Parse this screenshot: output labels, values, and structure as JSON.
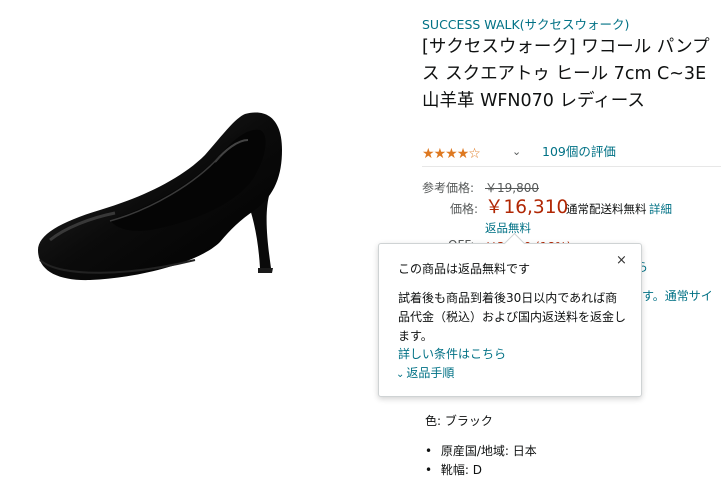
{
  "product": {
    "brand": "SUCCESS WALK(サクセスウォーク)",
    "title": "[サクセスウォーク] ワコール パンプス スクエアトゥ ヒール 7cm C~3E 山羊革 WFN070 レディース",
    "rating": {
      "stars": 4.0,
      "count_text": "109個の評価"
    }
  },
  "pricing": {
    "list_label": "参考価格:",
    "list_price": "￥19,800",
    "price_label": "価格:",
    "price": "￥16,310",
    "shipping": "通常配送料無料",
    "details_link": "詳細",
    "free_returns": "返品無料",
    "off_label": "OFF:",
    "off_value": "￥3,490 (18%)",
    "partial_link_1": "ら",
    "partial_link_2": "す。通常サイ"
  },
  "popover": {
    "title": "この商品は返品無料です",
    "close": "×",
    "body": "試着後も商品到着後30日以内であれば商品代金（税込）および国内返送料を返金します。",
    "conditions_link": "詳しい条件はこちら",
    "return_steps_link": "返品手順"
  },
  "specs": {
    "color_label": "色:",
    "color_value": "ブラック",
    "items": [
      {
        "label": "原産国/地域:",
        "value": "日本"
      },
      {
        "label": "靴幅:",
        "value": "D"
      }
    ]
  },
  "colors": {
    "link": "#007185",
    "price": "#b12704",
    "star": "#de7921"
  }
}
